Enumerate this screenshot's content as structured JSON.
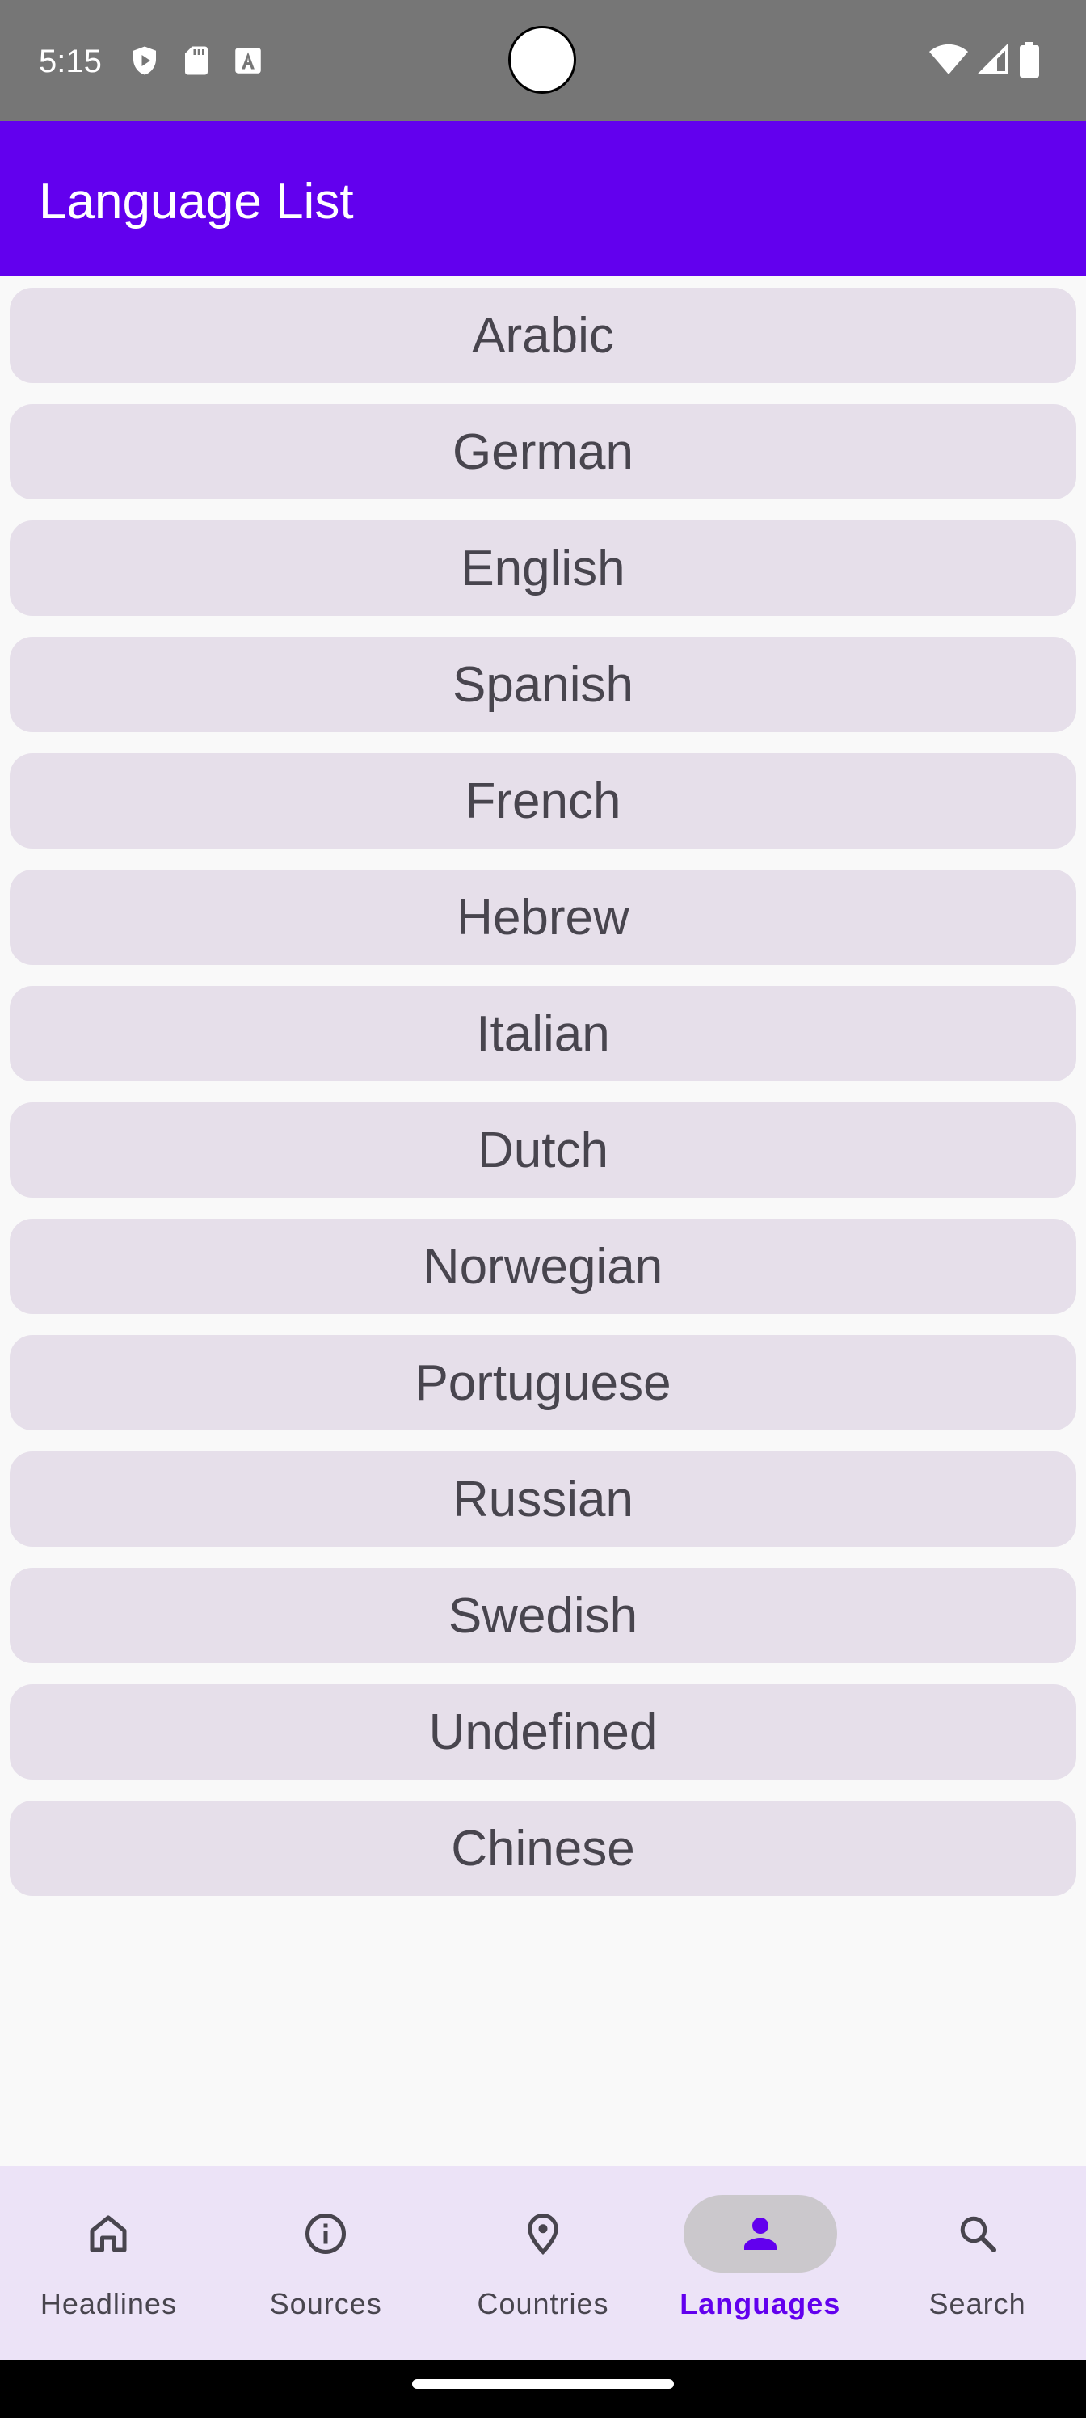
{
  "status_bar": {
    "time": "5:15",
    "left_icons": [
      "shield-play-icon",
      "sd-card-icon",
      "font-a-icon"
    ],
    "right_icons": [
      "wifi-icon",
      "signal-icon",
      "battery-icon"
    ]
  },
  "app_bar": {
    "title": "Language List"
  },
  "languages": [
    "Arabic",
    "German",
    "English",
    "Spanish",
    "French",
    "Hebrew",
    "Italian",
    "Dutch",
    "Norwegian",
    "Portuguese",
    "Russian",
    "Swedish",
    "Undefined",
    "Chinese"
  ],
  "bottom_nav": {
    "items": [
      {
        "label": "Headlines",
        "icon": "home-icon"
      },
      {
        "label": "Sources",
        "icon": "info-icon"
      },
      {
        "label": "Countries",
        "icon": "location-pin-icon"
      },
      {
        "label": "Languages",
        "icon": "person-icon"
      },
      {
        "label": "Search",
        "icon": "search-icon"
      }
    ],
    "active": "Languages"
  },
  "colors": {
    "primary": "#6200ee",
    "status_bar": "#767676",
    "list_item_bg": "#e6dfea",
    "nav_bg": "#ece3f7"
  }
}
